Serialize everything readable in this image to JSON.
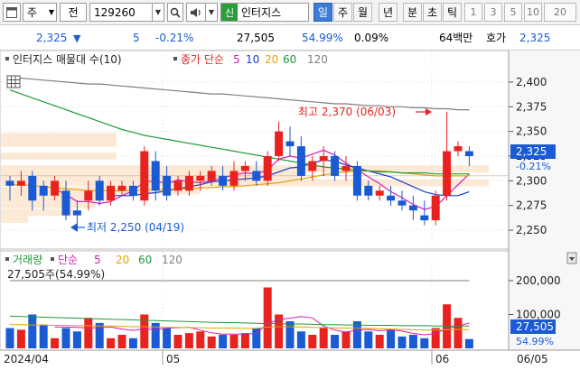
{
  "toolbar": {
    "market_label": "주",
    "prev_label": "전",
    "code": "129260",
    "stock_name_badge": "신",
    "stock_name": "인터지스",
    "periods": [
      {
        "label": "일",
        "active": true
      },
      {
        "label": "주",
        "active": false
      },
      {
        "label": "월",
        "active": false
      },
      {
        "label": "년",
        "active": false
      },
      {
        "label": "분",
        "active": false
      },
      {
        "label": "초",
        "active": false
      },
      {
        "label": "틱",
        "active": false
      }
    ],
    "intervals": [
      "1",
      "3",
      "5",
      "10",
      "20"
    ]
  },
  "quote": {
    "price": "2,325",
    "direction_arrow": "▼",
    "change": "5",
    "change_pct": "-0.21%",
    "volume": "27,505",
    "vol_ratio": "54.99%",
    "turnover_rate": "0.09%",
    "trade_value": "64백만",
    "bid_label": "호가",
    "bid_price": "2,325"
  },
  "price_panel": {
    "legend": {
      "title": "인터지스 매물대 수(10)",
      "ma_label": "종가 단순",
      "ma_periods": [
        {
          "label": "5",
          "color": "#d81bb4"
        },
        {
          "label": "10",
          "color": "#1c3cd6"
        },
        {
          "label": "20",
          "color": "#e6a200"
        },
        {
          "label": "60",
          "color": "#1e9a3a"
        },
        {
          "label": "120",
          "color": "#7f7f7f"
        }
      ]
    },
    "y_ticks": [
      "2,400",
      "2,375",
      "2,350",
      "2,325",
      "2,300",
      "2,275",
      "2,250"
    ],
    "current_price_tag": "2,325",
    "current_change_tag": "-0.21%",
    "high_annotation": "최고 2,370 (06/03)",
    "low_annotation": "최저 2,250 (04/19)",
    "up_color": "#e8231f",
    "down_color": "#1a5bd4"
  },
  "volume_panel": {
    "legend": {
      "title": "거래량",
      "ma_label": "단순",
      "ma_periods": [
        {
          "label": "5",
          "color": "#d81bb4"
        },
        {
          "label": "20",
          "color": "#e6a200"
        },
        {
          "label": "60",
          "color": "#1e9a3a"
        },
        {
          "label": "120",
          "color": "#7f7f7f"
        }
      ]
    },
    "current_label": "27,505주(54.99%)",
    "y_ticks": [
      "200,000",
      "100,000"
    ],
    "current_volume_tag": "27,505",
    "current_ratio_tag": "54.99%"
  },
  "x_axis": [
    "2024/04",
    "05",
    "06",
    "06/05"
  ],
  "chart_data": [
    {
      "type": "candlestick",
      "title": "인터지스 매물대 수(10)",
      "ylim": [
        2240,
        2410
      ],
      "series": [
        {
          "name": "candles",
          "ohlc": [
            [
              2300,
              2305,
              2280,
              2295
            ],
            [
              2295,
              2310,
              2285,
              2300
            ],
            [
              2305,
              2310,
              2270,
              2280
            ],
            [
              2295,
              2300,
              2270,
              2285
            ],
            [
              2285,
              2305,
              2280,
              2300
            ],
            [
              2290,
              2300,
              2260,
              2265
            ],
            [
              2270,
              2280,
              2255,
              2265
            ],
            [
              2280,
              2300,
              2270,
              2290
            ],
            [
              2300,
              2305,
              2275,
              2280
            ],
            [
              2280,
              2300,
              2275,
              2295
            ],
            [
              2290,
              2300,
              2285,
              2295
            ],
            [
              2295,
              2300,
              2280,
              2285
            ],
            [
              2280,
              2335,
              2275,
              2330
            ],
            [
              2320,
              2330,
              2280,
              2290
            ],
            [
              2305,
              2315,
              2280,
              2285
            ],
            [
              2290,
              2305,
              2285,
              2300
            ],
            [
              2290,
              2310,
              2285,
              2305
            ],
            [
              2300,
              2310,
              2290,
              2305
            ],
            [
              2300,
              2315,
              2295,
              2310
            ],
            [
              2305,
              2315,
              2290,
              2295
            ],
            [
              2295,
              2320,
              2290,
              2310
            ],
            [
              2310,
              2320,
              2300,
              2315
            ],
            [
              2310,
              2320,
              2295,
              2300
            ],
            [
              2300,
              2330,
              2295,
              2325
            ],
            [
              2325,
              2360,
              2320,
              2350
            ],
            [
              2340,
              2355,
              2325,
              2335
            ],
            [
              2335,
              2345,
              2300,
              2305
            ],
            [
              2310,
              2325,
              2300,
              2320
            ],
            [
              2320,
              2335,
              2305,
              2325
            ],
            [
              2325,
              2330,
              2300,
              2305
            ],
            [
              2310,
              2325,
              2300,
              2315
            ],
            [
              2315,
              2320,
              2280,
              2285
            ],
            [
              2295,
              2300,
              2280,
              2285
            ],
            [
              2285,
              2295,
              2280,
              2290
            ],
            [
              2285,
              2295,
              2275,
              2280
            ],
            [
              2280,
              2290,
              2270,
              2275
            ],
            [
              2275,
              2285,
              2260,
              2270
            ],
            [
              2265,
              2280,
              2255,
              2260
            ],
            [
              2260,
              2290,
              2255,
              2285
            ],
            [
              2285,
              2370,
              2280,
              2330
            ],
            [
              2330,
              2340,
              2325,
              2335
            ],
            [
              2330,
              2335,
              2315,
              2325
            ]
          ]
        },
        {
          "name": "5",
          "values": [
            null,
            null,
            null,
            null,
            2292,
            2286,
            2279,
            2279,
            2277,
            2279,
            2285,
            2290,
            2299,
            2300,
            2297,
            2301,
            2299,
            2298,
            2300,
            2303,
            2306,
            2308,
            2307,
            2311,
            2322,
            2325,
            2323,
            2327,
            2331,
            2326,
            2318,
            2311,
            2304,
            2297,
            2289,
            2283,
            2276,
            2271,
            2274,
            2285,
            2296,
            2307
          ]
        },
        {
          "name": "10",
          "values": [
            null,
            null,
            null,
            null,
            null,
            null,
            null,
            null,
            null,
            2285,
            2285,
            2285,
            2287,
            2288,
            2290,
            2292,
            2294,
            2296,
            2299,
            2300,
            2301,
            2302,
            2303,
            2305,
            2309,
            2313,
            2314,
            2318,
            2321,
            2320,
            2316,
            2313,
            2310,
            2307,
            2304,
            2299,
            2294,
            2289,
            2286,
            2285,
            2285,
            2289
          ]
        },
        {
          "name": "20",
          "values": [
            2296,
            2296,
            2295,
            2294,
            2293,
            2292,
            2291,
            2290,
            2290,
            2290,
            2290,
            2290,
            2291,
            2291,
            2291,
            2292,
            2292,
            2293,
            2293,
            2294,
            2294,
            2295,
            2296,
            2297,
            2298,
            2300,
            2302,
            2304,
            2306,
            2308,
            2309,
            2310,
            2310,
            2310,
            2309,
            2308,
            2307,
            2306,
            2305,
            2305,
            2305,
            2305
          ]
        },
        {
          "name": "60",
          "values": [
            2392,
            2388,
            2384,
            2380,
            2376,
            2372,
            2368,
            2364,
            2360,
            2356,
            2352,
            2349,
            2346,
            2344,
            2342,
            2340,
            2338,
            2336,
            2334,
            2332,
            2330,
            2328,
            2326,
            2324,
            2322,
            2320,
            2318,
            2316,
            2314,
            2313,
            2312,
            2311,
            2310,
            2309,
            2309,
            2308,
            2308,
            2308,
            2307,
            2307,
            2307,
            2307
          ]
        },
        {
          "name": "120",
          "values": [
            2405,
            2404,
            2403,
            2402,
            2401,
            2400,
            2399,
            2398,
            2398,
            2397,
            2396,
            2395,
            2394,
            2393,
            2392,
            2391,
            2390,
            2389,
            2388,
            2388,
            2387,
            2386,
            2385,
            2384,
            2383,
            2382,
            2381,
            2380,
            2379,
            2378,
            2378,
            2377,
            2376,
            2376,
            2375,
            2375,
            2374,
            2374,
            2373,
            2373,
            2372,
            2372
          ]
        }
      ]
    },
    {
      "type": "bar",
      "title": "거래량",
      "ylim": [
        0,
        240000
      ],
      "series": [
        {
          "name": "volume",
          "values": [
            60000,
            55000,
            100000,
            70000,
            30000,
            60000,
            50000,
            90000,
            75000,
            30000,
            40000,
            30000,
            100000,
            75000,
            60000,
            40000,
            45000,
            50000,
            35000,
            40000,
            40000,
            45000,
            60000,
            180000,
            100000,
            80000,
            50000,
            40000,
            60000,
            40000,
            50000,
            80000,
            50000,
            40000,
            55000,
            35000,
            40000,
            30000,
            60000,
            130000,
            90000,
            27505
          ]
        },
        {
          "name": "5",
          "values": [
            null,
            null,
            null,
            null,
            63000,
            63000,
            62000,
            60000,
            61000,
            63000,
            57000,
            53000,
            58000,
            55000,
            60000,
            61000,
            62000,
            54000,
            46000,
            42000,
            42000,
            42000,
            44000,
            73000,
            85000,
            89000,
            94000,
            90000,
            66000,
            54000,
            48000,
            54000,
            56000,
            52000,
            55000,
            51000,
            44000,
            40000,
            44000,
            59000,
            66000,
            75000
          ]
        },
        {
          "name": "20",
          "values": [
            70000,
            70000,
            69000,
            69000,
            68000,
            68000,
            67000,
            67000,
            66000,
            66000,
            65000,
            64000,
            64000,
            63000,
            62000,
            62000,
            61000,
            61000,
            60000,
            60000,
            60000,
            59000,
            59000,
            63000,
            64000,
            64000,
            63000,
            62000,
            61000,
            60000,
            60000,
            60000,
            59000,
            58000,
            57000,
            56000,
            55000,
            54000,
            54000,
            55000,
            56000,
            55000
          ]
        },
        {
          "name": "60",
          "values": [
            95000,
            94000,
            93000,
            92000,
            91000,
            90000,
            89000,
            88000,
            87000,
            86000,
            85000,
            84000,
            83000,
            82000,
            81000,
            80000,
            79000,
            78000,
            77000,
            76000,
            76000,
            75000,
            74000,
            73000,
            73000,
            72000,
            72000,
            71000,
            70000,
            70000,
            69000,
            69000,
            68000,
            68000,
            68000,
            67000,
            67000,
            67000,
            66000,
            66000,
            66000,
            66000
          ]
        },
        {
          "name": "120",
          "values": [
            200000,
            200000,
            200000,
            200000,
            200000,
            200000,
            200000,
            200000,
            200000,
            200000,
            200000,
            200000,
            200000,
            200000,
            200000,
            200000,
            200000,
            200000,
            200000,
            200000,
            200000,
            200000,
            200000,
            200000,
            200000,
            200000,
            200000,
            200000,
            200000,
            200000,
            200000,
            200000,
            200000,
            200000,
            200000,
            200000,
            200000,
            200000,
            200000,
            200000,
            200000,
            200000
          ]
        }
      ]
    }
  ]
}
